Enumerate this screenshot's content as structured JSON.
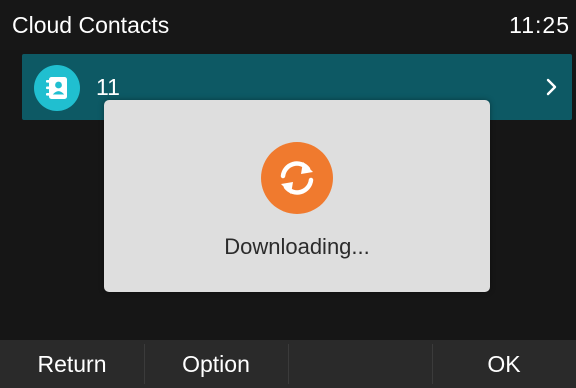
{
  "header": {
    "title": "Cloud Contacts",
    "time": "11:25"
  },
  "contacts": [
    {
      "label": "11",
      "icon": "contacts-book-icon"
    }
  ],
  "dialog": {
    "message": "Downloading...",
    "icon": "sync-icon"
  },
  "softkeys": [
    "Return",
    "Option",
    "",
    "OK"
  ],
  "colors": {
    "row_bg": "#0d5964",
    "row_icon_bg": "#20bfd0",
    "dialog_icon_bg": "#f07a2e",
    "dialog_bg": "#dedede",
    "softkey_bg": "#2a2a2a"
  }
}
